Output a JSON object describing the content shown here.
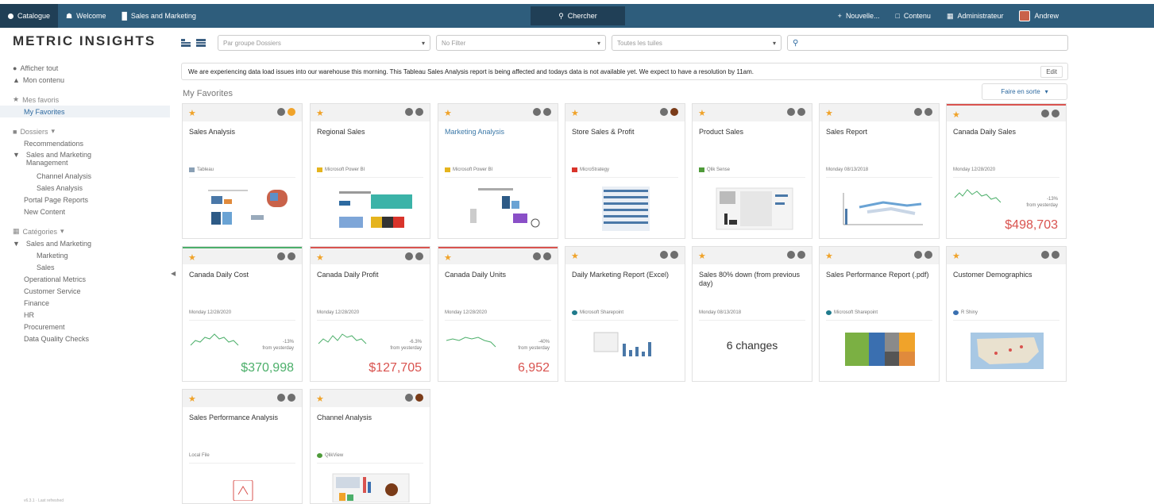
{
  "topbar": {
    "catalogue": "Catalogue",
    "welcome": "Welcome",
    "sales_marketing": "Sales and Marketing",
    "search": "Chercher",
    "new": "Nouvelle...",
    "contents": "Contenu",
    "admin": "Administrateur",
    "user": "Andrew"
  },
  "logo": "METRIC INSIGHTS",
  "sidebar": {
    "show_all": "Afficher tout",
    "my_content": "Mon contenu",
    "my_favorites_head": "Mes favoris",
    "my_favorites": "My Favorites",
    "folders": "Dossiers",
    "recommendations": "Recommendations",
    "sales_mkt_mgmt": "Sales and Marketing Management",
    "channel_analysis": "Channel Analysis",
    "sales_analysis": "Sales Analysis",
    "portal_reports": "Portal Page Reports",
    "new_content": "New Content",
    "categories": "Catégories",
    "sales_and_marketing": "Sales and Marketing",
    "marketing": "Marketing",
    "sales": "Sales",
    "operational": "Operational Metrics",
    "customer_service": "Customer Service",
    "finance": "Finance",
    "hr": "HR",
    "procurement": "Procurement",
    "dq_checks": "Data Quality Checks",
    "footnote": "v6.3.1 · Last refreshed"
  },
  "toolbar": {
    "groups_placeholder": "Par groupe Dossiers",
    "filter_placeholder": "No Filter",
    "tiles_placeholder": "Toutes les tuiles"
  },
  "banner": {
    "text": "We are experiencing data load issues into our warehouse this morning. This Tableau Sales Analysis report is being affected and todays data is not available yet. We expect to have a resolution by 11am.",
    "edit": "Edit"
  },
  "section_title": "My Favorites",
  "sort_label": "Faire en sorte",
  "tiles": [
    {
      "title": "Sales Analysis",
      "source": "Tableau",
      "src_color": "#8aa0b5"
    },
    {
      "title": "Regional Sales",
      "source": "Microsoft Power BI",
      "src_color": "#e5b41e"
    },
    {
      "title": "Marketing Analysis",
      "source": "Microsoft Power BI",
      "src_color": "#e5b41e"
    },
    {
      "title": "Store Sales & Profit",
      "source": "MicroStrategy",
      "src_color": "#d9342b"
    },
    {
      "title": "Product Sales",
      "source": "Qlik Sense",
      "src_color": "#4f9b3a"
    },
    {
      "title": "Sales Report",
      "source": "Monday 08/13/2018"
    },
    {
      "title": "Canada Daily Sales",
      "source": "Monday 12/28/2020",
      "change": "-13%",
      "change_sub": "from yesterday",
      "value": "$498,703",
      "value_color": "#d9534f"
    },
    {
      "title": "Canada Daily Cost",
      "source": "Monday 12/28/2020",
      "change": "-13%",
      "change_sub": "from yesterday",
      "value": "$370,998",
      "value_color": "#4caf6a"
    },
    {
      "title": "Canada Daily Profit",
      "source": "Monday 12/28/2020",
      "change": "-6.3%",
      "change_sub": "from yesterday",
      "value": "$127,705",
      "value_color": "#d9534f"
    },
    {
      "title": "Canada Daily Units",
      "source": "Monday 12/28/2020",
      "change": "-40%",
      "change_sub": "from yesterday",
      "value": "6,952",
      "value_color": "#d9534f"
    },
    {
      "title": "Daily Marketing Report (Excel)",
      "source": "Microsoft Sharepoint",
      "src_color": "#1f7a8c"
    },
    {
      "title": "Sales 80% down (from previous day)",
      "source": "Monday 08/13/2018",
      "changes": "6 changes"
    },
    {
      "title": "Sales Performance Report (.pdf)",
      "source": "Microsoft Sharepoint",
      "src_color": "#1f7a8c"
    },
    {
      "title": "Customer Demographics",
      "source": "R Shiny",
      "src_color": "#3a6fb0"
    },
    {
      "title": "Sales Performance Analysis",
      "source": "Local File"
    },
    {
      "title": "Channel Analysis",
      "source": "QlikView",
      "src_color": "#4f9b3a"
    }
  ]
}
